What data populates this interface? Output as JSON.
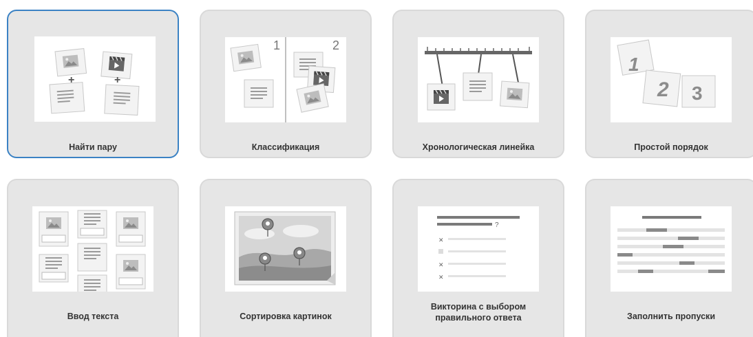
{
  "templates": [
    {
      "label": "Найти пару",
      "selected": true
    },
    {
      "label": "Классификация",
      "number_1": "1",
      "number_2": "2"
    },
    {
      "label": "Хронологическая линейка"
    },
    {
      "label": "Простой порядок",
      "number_1": "1",
      "number_2": "2",
      "number_3": "3"
    },
    {
      "label": "Ввод текста"
    },
    {
      "label": "Сортировка картинок"
    },
    {
      "label": "Викторина с выбором правильного ответа",
      "line_1": "Викторина с выбором",
      "line_2": "правильного ответа"
    },
    {
      "label": "Заполнить пропуски"
    }
  ],
  "colors": {
    "card_bg": "#e6e6e6",
    "selected_border": "#3b82c4",
    "icon_gray": "#9a9a9a"
  }
}
